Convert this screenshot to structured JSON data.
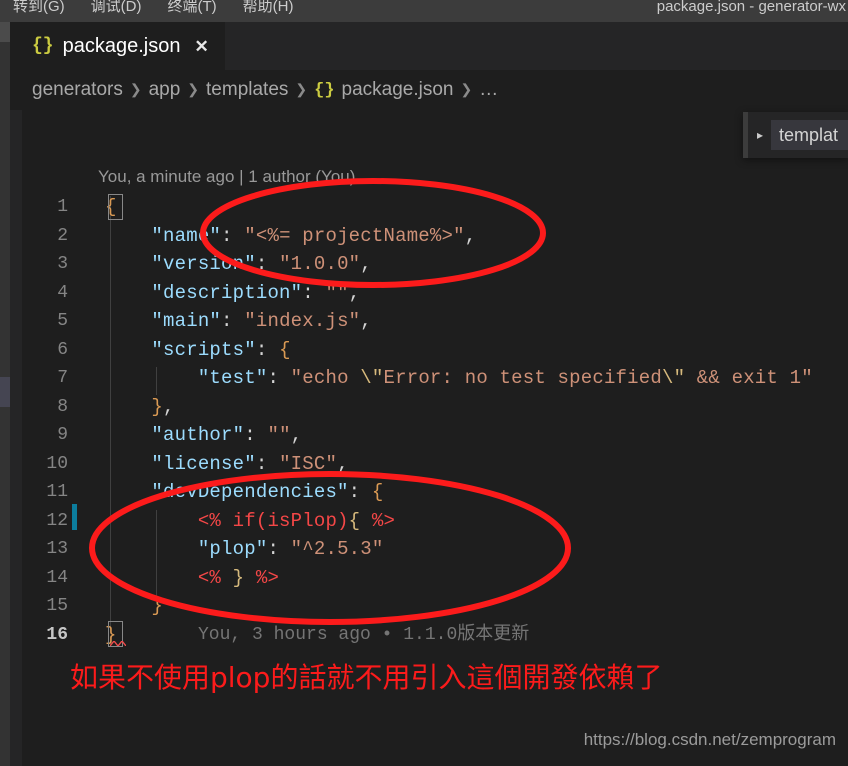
{
  "window": {
    "title": "package.json - generator-wx",
    "menu": [
      {
        "label": "转到(G)"
      },
      {
        "label": "调试(D)"
      },
      {
        "label": "终端(T)"
      },
      {
        "label": "帮助(H)"
      }
    ]
  },
  "tab": {
    "icon": "json-braces-icon",
    "label": "package.json",
    "close": "✕"
  },
  "breadcrumb": {
    "separator": "❯",
    "items": [
      {
        "label": "generators"
      },
      {
        "label": "app"
      },
      {
        "label": "templates"
      },
      {
        "label": "package.json",
        "icon": "json-braces-icon"
      },
      {
        "label": "…"
      }
    ],
    "json_icon_glyph": "{}"
  },
  "breadcrumb_popup": {
    "chevron": "▸",
    "label": "templat"
  },
  "editor": {
    "codelens": "You, a minute ago | 1 author (You)",
    "inline_blame": "You, 3 hours ago • 1.1.0版本更新",
    "lines": [
      {
        "n": "1",
        "text": "{"
      },
      {
        "n": "2",
        "text": "    \"name\": \"<%= projectName%>\","
      },
      {
        "n": "3",
        "text": "    \"version\": \"1.0.0\","
      },
      {
        "n": "4",
        "text": "    \"description\": \"\","
      },
      {
        "n": "5",
        "text": "    \"main\": \"index.js\","
      },
      {
        "n": "6",
        "text": "    \"scripts\": {"
      },
      {
        "n": "7",
        "text": "        \"test\": \"echo \\\"Error: no test specified\\\" && exit 1\""
      },
      {
        "n": "8",
        "text": "    },"
      },
      {
        "n": "9",
        "text": "    \"author\": \"\","
      },
      {
        "n": "10",
        "text": "    \"license\": \"ISC\","
      },
      {
        "n": "11",
        "text": "    \"devDependencies\": {"
      },
      {
        "n": "12",
        "text": "        <% if(isPlop){ %>"
      },
      {
        "n": "13",
        "text": "        \"plop\": \"^2.5.3\""
      },
      {
        "n": "14",
        "text": "        <% } %>"
      },
      {
        "n": "15",
        "text": "    }"
      },
      {
        "n": "16",
        "text": "}"
      }
    ],
    "current_line": "16"
  },
  "annotation": {
    "text": "如果不使用plop的話就不用引入這個開發依賴了",
    "color": "#fc1b1b",
    "ellipse_count": 2
  },
  "watermark": {
    "text": "https://blog.csdn.net/zemprogram"
  },
  "colors": {
    "editor_background": "#1e1e1e",
    "tabbar_background": "#252526",
    "titlebar_background": "#3c3c3c",
    "json_key": "#9cdcfe",
    "json_string": "#ce9178",
    "annotation_red": "#fc1b1b",
    "change_marker": "#0c7d9d"
  }
}
